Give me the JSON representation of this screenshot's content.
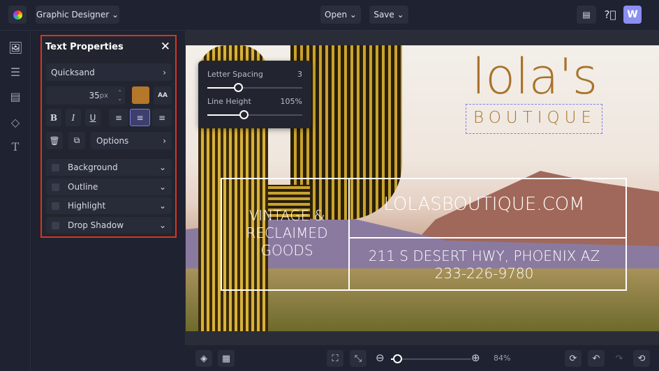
{
  "topbar": {
    "app_name": "Graphic Designer",
    "open": "Open",
    "save": "Save",
    "avatar": "W"
  },
  "panel": {
    "title": "Text Properties",
    "font": "Quicksand",
    "size": "35",
    "unit": "px",
    "color": "#b5772a",
    "options": "Options",
    "sections": [
      {
        "label": "Background"
      },
      {
        "label": "Outline"
      },
      {
        "label": "Highlight"
      },
      {
        "label": "Drop Shadow"
      }
    ]
  },
  "popover": {
    "letter_spacing_label": "Letter Spacing",
    "letter_spacing_value": "3",
    "letter_spacing_fraction": 0.32,
    "line_height_label": "Line Height",
    "line_height_value": "105%",
    "line_height_fraction": 0.38
  },
  "design": {
    "logo": "lola's",
    "subtitle": "BOUTIQUE",
    "left_text": "VINTAGE & RECLAIMED GOODS",
    "url": "LOLASBOUTIQUE.COM",
    "address": "211 S DESERT HWY, PHOENIX AZ",
    "phone": "233-226-9780"
  },
  "bottom": {
    "zoom": "84%",
    "zoom_fraction": 0.08
  }
}
